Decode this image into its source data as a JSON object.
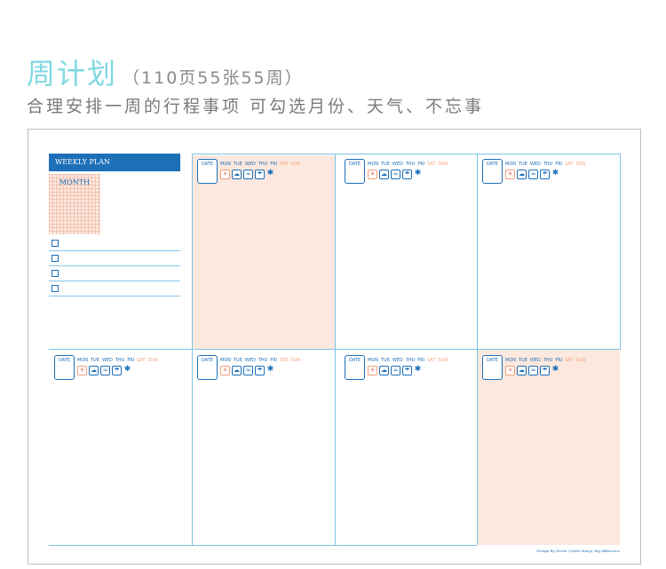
{
  "header": {
    "title": "周计划",
    "title_sub": "（110页55张55周）",
    "subtitle": "合理安排一周的行程事项 可勾选月份、天气、不忘事"
  },
  "weekly_plan": {
    "label": "WEEKLY PLAN",
    "month_label": "MONTH",
    "todo_count": 4
  },
  "day_block": {
    "date_label": "DATE",
    "days": [
      "MON",
      "TUE",
      "WED",
      "THU",
      "FRI",
      "SAT",
      "SUN"
    ],
    "weather_icons": [
      "sun-icon",
      "cloud-icon",
      "wind-icon",
      "rain-icon",
      "snow-icon"
    ]
  },
  "colors": {
    "title": "#7fd9e0",
    "accent_blue": "#1d6fb8",
    "line_blue": "#7ec3e6",
    "peach": "#fce8de",
    "weekend": "#f2a07c"
  },
  "credit": "Design By Green | Little things, big difference."
}
